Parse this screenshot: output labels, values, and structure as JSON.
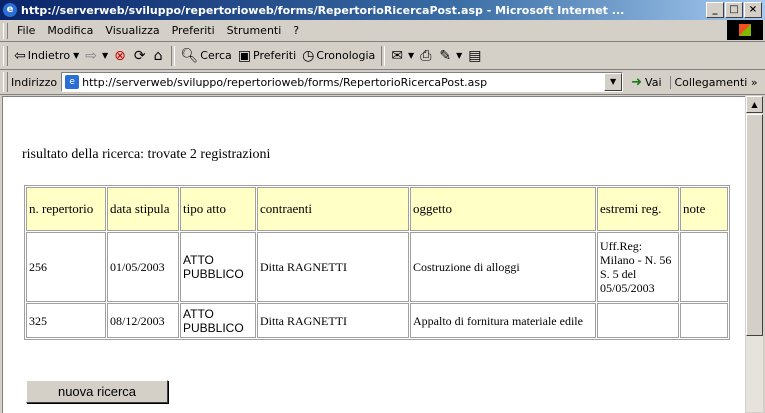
{
  "window": {
    "title": "http://serverweb/sviluppo/repertorioweb/forms/RepertorioRicercaPost.asp - Microsoft Internet ...",
    "min": "_",
    "max": "□",
    "close": "×"
  },
  "menu": [
    "File",
    "Modifica",
    "Visualizza",
    "Preferiti",
    "Strumenti",
    "?"
  ],
  "toolbar": {
    "back": "Indietro",
    "search": "Cerca",
    "favorites": "Preferiti",
    "history": "Cronologia"
  },
  "address": {
    "label": "Indirizzo",
    "url": "http://serverweb/sviluppo/repertorioweb/forms/RepertorioRicercaPost.asp",
    "go": "Vai",
    "links": "Collegamenti »"
  },
  "page": {
    "result_text": "risultato della ricerca: trovate 2 registrazioni",
    "headers": [
      "n. repertorio",
      "data stipula",
      "tipo atto",
      "contraenti",
      "oggetto",
      "estremi reg.",
      "note"
    ],
    "rows": [
      [
        "256",
        "01/05/2003",
        "ATTO PUBBLICO",
        "Ditta RAGNETTI",
        "Costruzione di alloggi",
        "Uff.Reg: Milano - N. 56 S. 5 del 05/05/2003",
        ""
      ],
      [
        "325",
        "08/12/2003",
        "ATTO PUBBLICO",
        "Ditta RAGNETTI",
        "Appalto di fornitura materiale edile",
        "",
        ""
      ]
    ],
    "new_search": "nuova ricerca"
  }
}
